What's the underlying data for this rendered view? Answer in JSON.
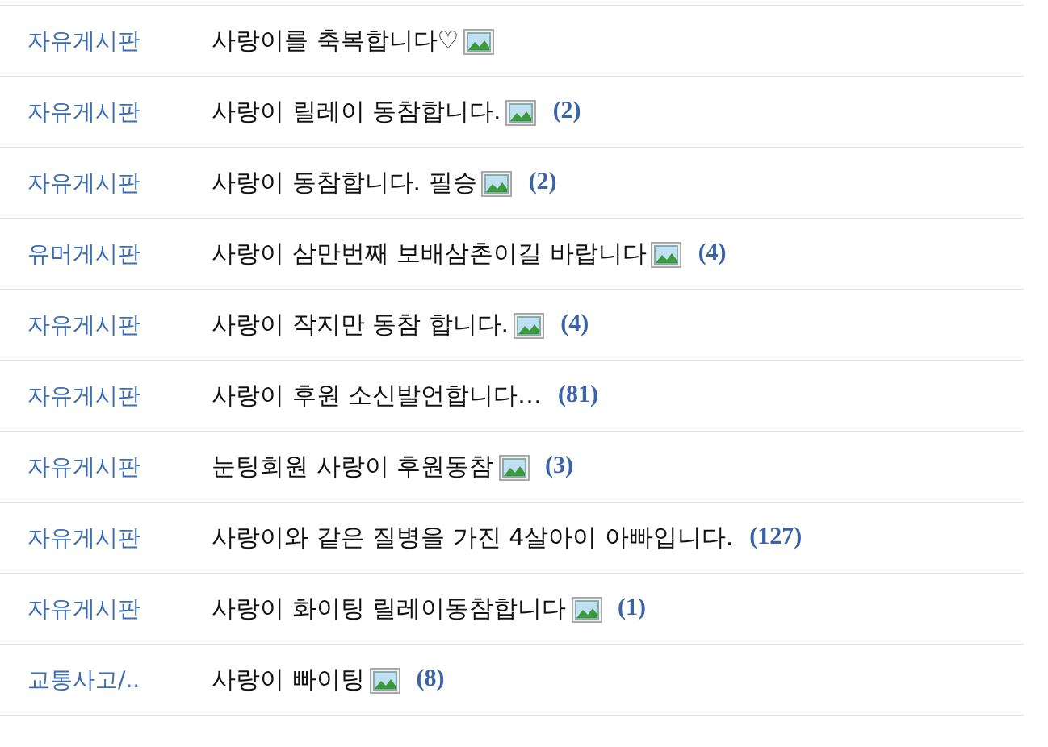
{
  "posts": [
    {
      "board": "자유게시판",
      "title": "사랑이를 축복합니다♡",
      "has_image": true
    },
    {
      "board": "자유게시판",
      "title": "사랑이 릴레이 동참합니다.",
      "has_image": true,
      "comments": "(2)"
    },
    {
      "board": "자유게시판",
      "title": "사랑이 동참합니다. 필승",
      "has_image": true,
      "comments": "(2)"
    },
    {
      "board": "유머게시판",
      "title": "사랑이 삼만번째 보배삼촌이길 바랍니다",
      "has_image": true,
      "comments": "(4)"
    },
    {
      "board": "자유게시판",
      "title": "사랑이 작지만 동참 합니다.",
      "has_image": true,
      "comments": "(4)"
    },
    {
      "board": "자유게시판",
      "title": "사랑이 후원 소신발언합니다…",
      "has_image": false,
      "comments": "(81)"
    },
    {
      "board": "자유게시판",
      "title": "눈팅회원 사랑이 후원동참",
      "has_image": true,
      "comments": "(3)"
    },
    {
      "board": "자유게시판",
      "title": "사랑이와 같은 질병을 가진 4살아이 아빠입니다.",
      "has_image": false,
      "comments": "(127)"
    },
    {
      "board": "자유게시판",
      "title": "사랑이 화이팅 릴레이동참합니다",
      "has_image": true,
      "comments": "(1)"
    },
    {
      "board": "교통사고/..",
      "title": "사랑이 빠이팅",
      "has_image": true,
      "comments": "(8)"
    }
  ]
}
